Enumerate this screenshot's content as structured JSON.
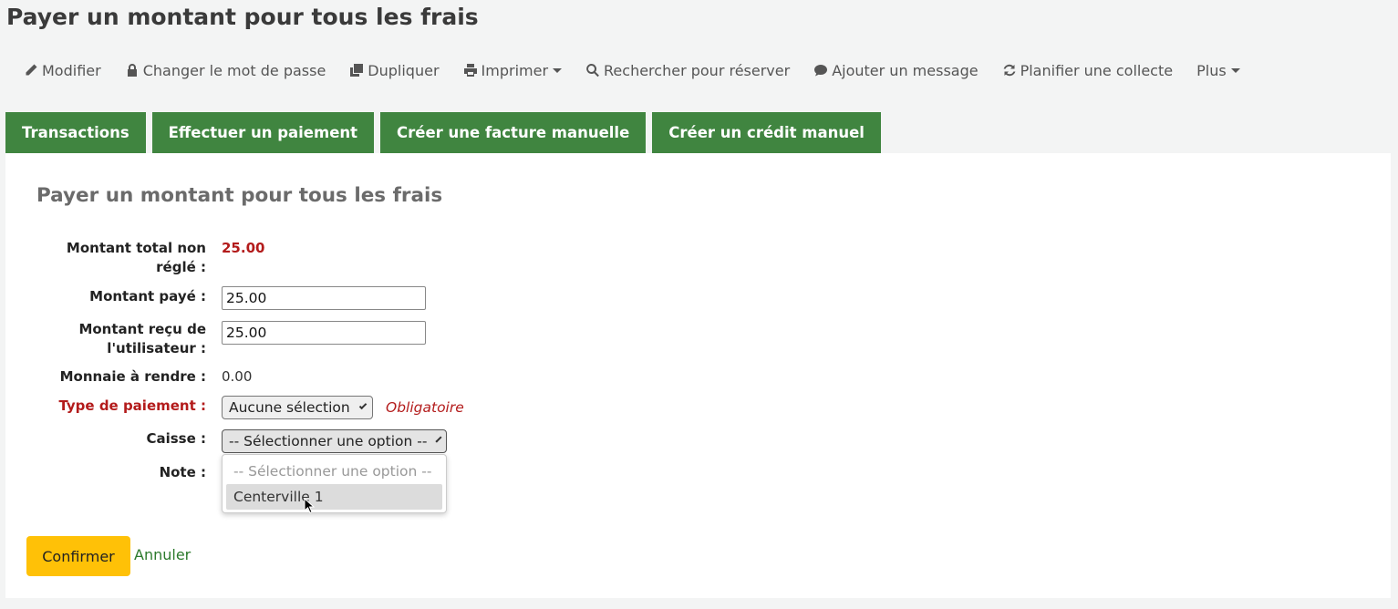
{
  "page": {
    "title": "Payer un montant pour tous les frais"
  },
  "toolbar": {
    "items": [
      {
        "label": "Modifier",
        "icon": "pencil-icon"
      },
      {
        "label": "Changer le mot de passe",
        "icon": "lock-icon"
      },
      {
        "label": "Dupliquer",
        "icon": "copy-icon"
      },
      {
        "label": "Imprimer",
        "icon": "print-icon"
      },
      {
        "label": "Rechercher pour réserver",
        "icon": "search-icon"
      },
      {
        "label": "Ajouter un message",
        "icon": "comment-icon"
      },
      {
        "label": "Planifier une collecte",
        "icon": "refresh-icon"
      },
      {
        "label": "Plus"
      }
    ]
  },
  "tabs": [
    {
      "label": "Transactions"
    },
    {
      "label": "Effectuer un paiement"
    },
    {
      "label": "Créer une facture manuelle"
    },
    {
      "label": "Créer un crédit manuel"
    }
  ],
  "form": {
    "legend": "Payer un montant pour tous les frais",
    "total_label": "Montant total non réglé :",
    "total_value": "25.00",
    "paid_label": "Montant payé :",
    "paid_value": "25.00",
    "received_label": "Montant reçu de l'utilisateur :",
    "received_value": "25.00",
    "change_label": "Monnaie à rendre :",
    "change_value": "0.00",
    "payment_type_label": "Type de paiement :",
    "payment_type_value": "Aucune sélection",
    "required_text": "Obligatoire",
    "register_label": "Caisse :",
    "register_value": "-- Sélectionner une option --",
    "register_options": [
      "-- Sélectionner une option --",
      "Centerville 1"
    ],
    "note_label": "Note :"
  },
  "actions": {
    "confirm": "Confirmer",
    "cancel": "Annuler"
  },
  "colors": {
    "tab_green": "#408540",
    "required_red": "#b31b1b",
    "confirm_yellow": "#ffc107",
    "link_green": "#2c7a2c"
  }
}
